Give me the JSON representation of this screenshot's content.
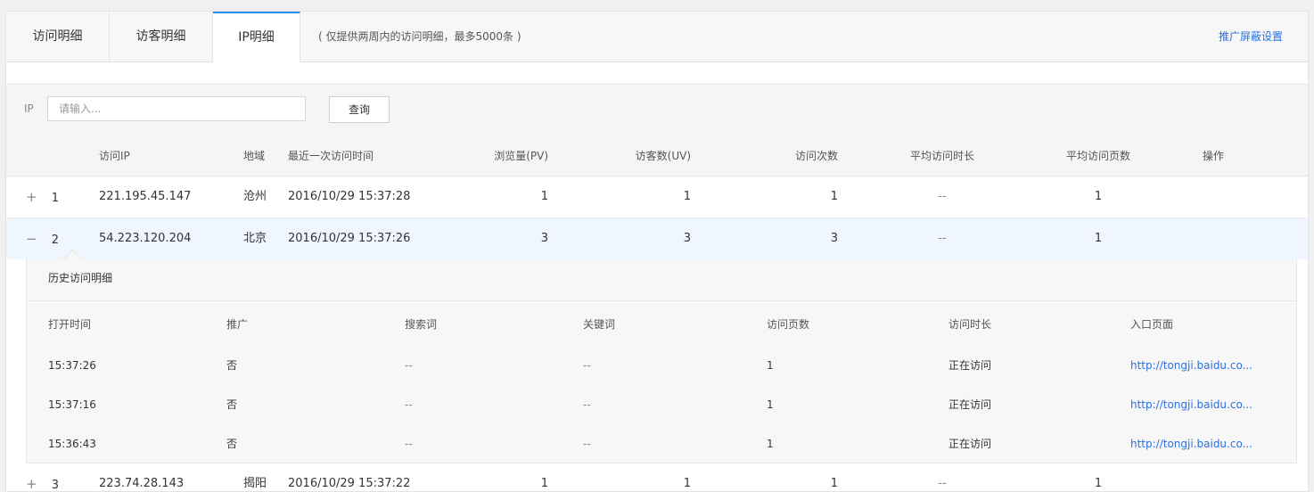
{
  "tabs": {
    "visit_detail": "访问明细",
    "visitor_detail": "访客明细",
    "ip_detail": "IP明细",
    "note": "( 仅提供两周内的访问明细，最多5000条 )",
    "shield_settings": "推广屏蔽设置"
  },
  "filter": {
    "ip_label": "IP",
    "ip_placeholder": "请输入...",
    "query_button": "查询"
  },
  "table": {
    "headers": {
      "ip": "访问IP",
      "region": "地域",
      "last_visit": "最近一次访问时间",
      "pv": "浏览量(PV)",
      "uv": "访客数(UV)",
      "visits": "访问次数",
      "avg_duration": "平均访问时长",
      "avg_pages": "平均访问页数",
      "actions": "操作"
    },
    "rows": [
      {
        "toggle": "+",
        "index": "1",
        "ip": "221.195.45.147",
        "region": "沧州",
        "last_visit": "2016/10/29 15:37:28",
        "pv": "1",
        "uv": "1",
        "visits": "1",
        "avg_duration": "--",
        "avg_pages": "1"
      },
      {
        "toggle": "−",
        "index": "2",
        "ip": "54.223.120.204",
        "region": "北京",
        "last_visit": "2016/10/29 15:37:26",
        "pv": "3",
        "uv": "3",
        "visits": "3",
        "avg_duration": "--",
        "avg_pages": "1"
      },
      {
        "toggle": "+",
        "index": "3",
        "ip": "223.74.28.143",
        "region": "揭阳",
        "last_visit": "2016/10/29 15:37:22",
        "pv": "1",
        "uv": "1",
        "visits": "1",
        "avg_duration": "--",
        "avg_pages": "1"
      }
    ]
  },
  "history": {
    "title": "历史访问明细",
    "headers": {
      "open_time": "打开时间",
      "promotion": "推广",
      "search_term": "搜索词",
      "keyword": "关键词",
      "pages": "访问页数",
      "duration": "访问时长",
      "entry_page": "入口页面"
    },
    "rows": [
      {
        "open_time": "15:37:26",
        "promotion": "否",
        "search_term": "--",
        "keyword": "--",
        "pages": "1",
        "duration": "正在访问",
        "entry_page": "http://tongji.baidu.co..."
      },
      {
        "open_time": "15:37:16",
        "promotion": "否",
        "search_term": "--",
        "keyword": "--",
        "pages": "1",
        "duration": "正在访问",
        "entry_page": "http://tongji.baidu.co..."
      },
      {
        "open_time": "15:36:43",
        "promotion": "否",
        "search_term": "--",
        "keyword": "--",
        "pages": "1",
        "duration": "正在访问",
        "entry_page": "http://tongji.baidu.co..."
      }
    ]
  },
  "colors": {
    "accent": "#2b8de6",
    "link": "#2b6fe0",
    "expanded_row_bg": "#f0f6ff"
  }
}
